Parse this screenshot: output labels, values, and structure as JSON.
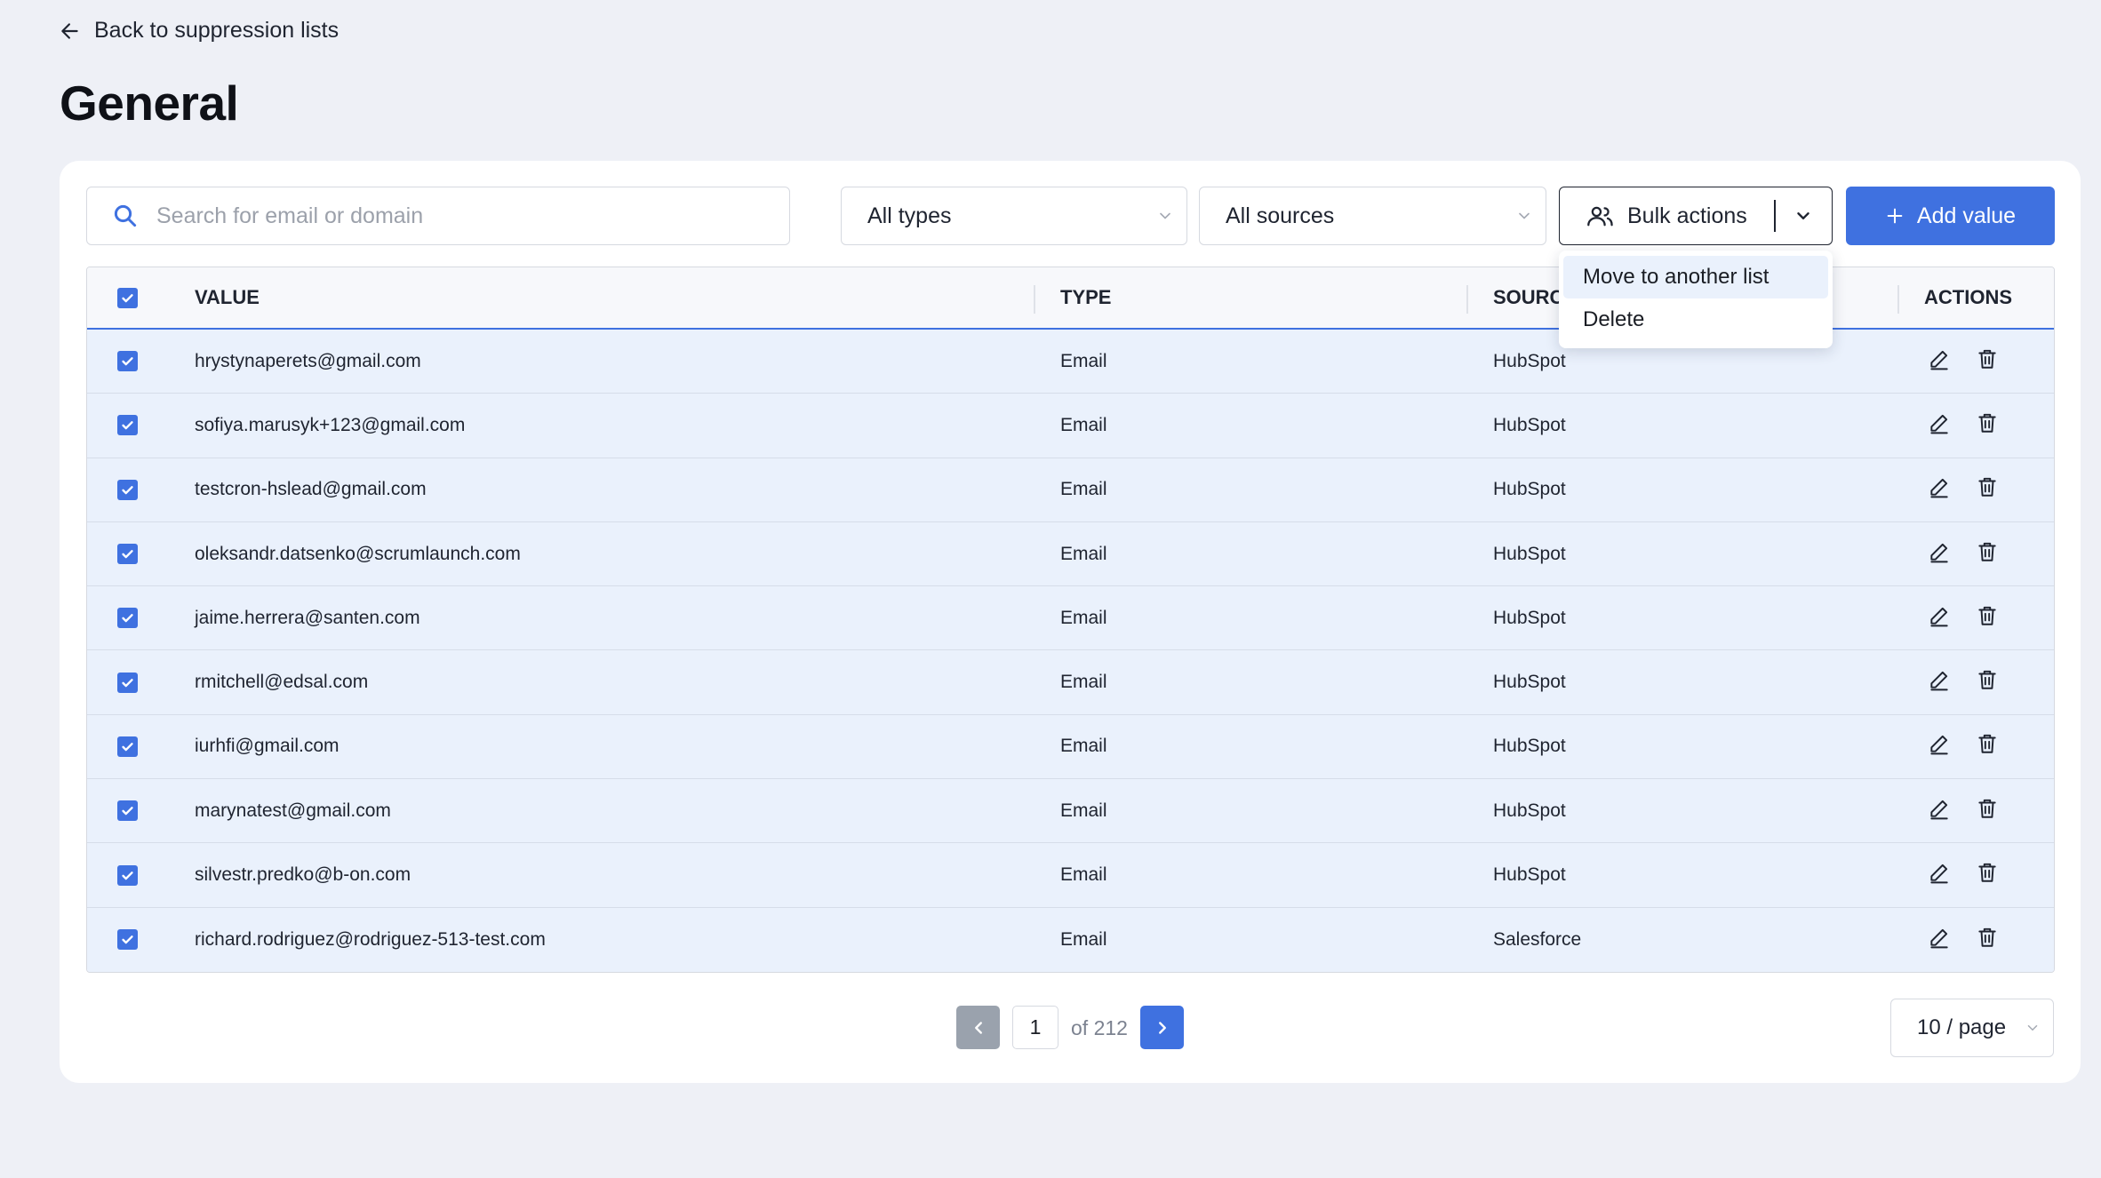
{
  "nav": {
    "back_label": "Back to suppression lists"
  },
  "page": {
    "title": "General"
  },
  "toolbar": {
    "search_placeholder": "Search for email or domain",
    "type_filter": "All types",
    "source_filter": "All sources",
    "bulk_label": "Bulk actions",
    "add_label": "Add value"
  },
  "bulk_menu": {
    "items": [
      {
        "label": "Move to another list"
      },
      {
        "label": "Delete"
      }
    ]
  },
  "table": {
    "headers": {
      "value": "VALUE",
      "type": "TYPE",
      "source": "SOURCE",
      "actions": "ACTIONS"
    },
    "rows": [
      {
        "value": "hrystynaperets@gmail.com",
        "type": "Email",
        "source": "HubSpot",
        "checked": true
      },
      {
        "value": "sofiya.marusyk+123@gmail.com",
        "type": "Email",
        "source": "HubSpot",
        "checked": true
      },
      {
        "value": "testcron-hslead@gmail.com",
        "type": "Email",
        "source": "HubSpot",
        "checked": true
      },
      {
        "value": "oleksandr.datsenko@scrumlaunch.com",
        "type": "Email",
        "source": "HubSpot",
        "checked": true
      },
      {
        "value": "jaime.herrera@santen.com",
        "type": "Email",
        "source": "HubSpot",
        "checked": true
      },
      {
        "value": "rmitchell@edsal.com",
        "type": "Email",
        "source": "HubSpot",
        "checked": true
      },
      {
        "value": "iurhfi@gmail.com",
        "type": "Email",
        "source": "HubSpot",
        "checked": true
      },
      {
        "value": "marynatest@gmail.com",
        "type": "Email",
        "source": "HubSpot",
        "checked": true
      },
      {
        "value": "silvestr.predko@b-on.com",
        "type": "Email",
        "source": "HubSpot",
        "checked": true
      },
      {
        "value": "richard.rodriguez@rodriguez-513-test.com",
        "type": "Email",
        "source": "Salesforce",
        "checked": true
      }
    ]
  },
  "pagination": {
    "current_page": "1",
    "total_label": "of 212",
    "page_size": "10 / page"
  },
  "colors": {
    "accent": "#3f71e0",
    "row_selected": "#eaf1fc",
    "background": "#eef0f6"
  }
}
